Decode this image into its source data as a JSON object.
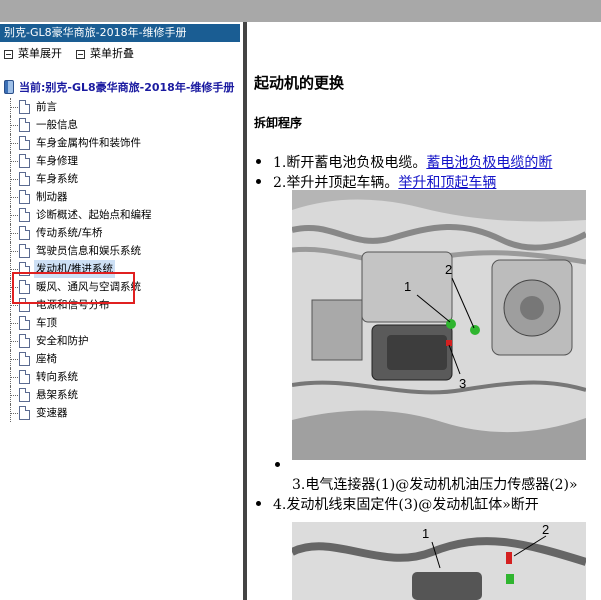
{
  "window": {
    "title": "别克-GL8豪华商旅-2018年-维修手册"
  },
  "menu": {
    "expand_label": "菜单展开",
    "collapse_label": "菜单折叠"
  },
  "tree": {
    "current_label": "当前:别克-GL8豪华商旅-2018年-维修手册",
    "items": [
      {
        "label": "前言"
      },
      {
        "label": "一般信息"
      },
      {
        "label": "车身金属构件和装饰件"
      },
      {
        "label": "车身修理"
      },
      {
        "label": "车身系统"
      },
      {
        "label": "制动器"
      },
      {
        "label": "诊断概述、起始点和编程"
      },
      {
        "label": "传动系统/车桥"
      },
      {
        "label": "驾驶员信息和娱乐系统"
      },
      {
        "label": "发动机/推进系统",
        "selected": true
      },
      {
        "label": "暖风、通风与空调系统"
      },
      {
        "label": "电源和信号分布"
      },
      {
        "label": "车顶"
      },
      {
        "label": "安全和防护"
      },
      {
        "label": "座椅"
      },
      {
        "label": "转向系统"
      },
      {
        "label": "悬架系统"
      },
      {
        "label": "变速器"
      }
    ]
  },
  "content": {
    "title": "起动机的更换",
    "subtitle": "拆卸程序",
    "steps": [
      {
        "text": "1.断开蓄电池负极电缆。",
        "link": "蓄电池负极电缆的断"
      },
      {
        "text": "2.举升并顶起车辆。",
        "link": "举升和顶起车辆"
      },
      {
        "text": "3.电气连接器(1)@发动机机油压力传感器(2)»",
        "link": ""
      },
      {
        "text": "4.发动机线束固定件(3)@发动机缸体»断开",
        "link": ""
      }
    ],
    "figure1": {
      "callouts": [
        "1",
        "2",
        "3"
      ]
    },
    "figure2": {
      "callouts": [
        "1",
        "2"
      ]
    }
  },
  "colors": {
    "titlebar": "#1a5d93",
    "link": "#1414c8",
    "highlight_box": "#e02020",
    "selected_bg": "#cde0f5"
  }
}
